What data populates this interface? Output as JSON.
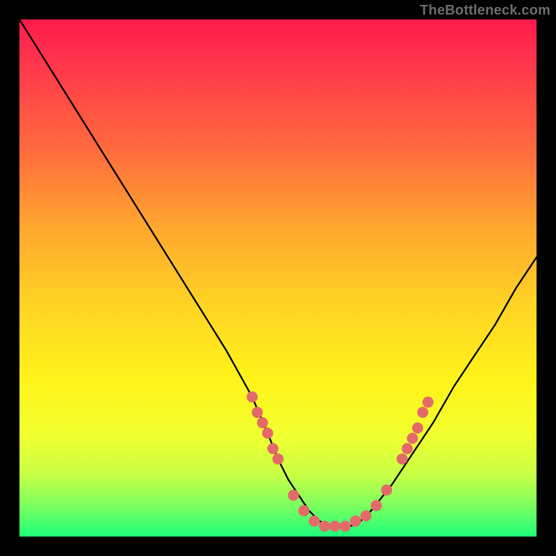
{
  "watermark": "TheBottleneck.com",
  "chart_data": {
    "type": "line",
    "title": "",
    "xlabel": "",
    "ylabel": "",
    "xlim": [
      0,
      100
    ],
    "ylim": [
      0,
      100
    ],
    "series": [
      {
        "name": "bottleneck-curve",
        "x": [
          0,
          5,
          10,
          15,
          20,
          25,
          30,
          35,
          40,
          45,
          48,
          50,
          52,
          54,
          56,
          58,
          60,
          62,
          64,
          66,
          68,
          72,
          76,
          80,
          84,
          88,
          92,
          96,
          100
        ],
        "y": [
          100,
          92,
          84,
          76,
          68,
          60,
          52,
          44,
          36,
          27,
          20,
          15,
          11,
          8,
          5,
          3,
          2,
          2,
          2,
          3,
          5,
          10,
          16,
          22,
          29,
          35,
          41,
          48,
          54
        ]
      }
    ],
    "markers": {
      "name": "highlight-dots",
      "color": "#e46a6a",
      "radius_px": 8,
      "points": [
        {
          "x": 45,
          "y": 27
        },
        {
          "x": 46,
          "y": 24
        },
        {
          "x": 47,
          "y": 22
        },
        {
          "x": 48,
          "y": 20
        },
        {
          "x": 49,
          "y": 17
        },
        {
          "x": 50,
          "y": 15
        },
        {
          "x": 53,
          "y": 8
        },
        {
          "x": 55,
          "y": 5
        },
        {
          "x": 57,
          "y": 3
        },
        {
          "x": 59,
          "y": 2
        },
        {
          "x": 61,
          "y": 2
        },
        {
          "x": 63,
          "y": 2
        },
        {
          "x": 65,
          "y": 3
        },
        {
          "x": 67,
          "y": 4
        },
        {
          "x": 69,
          "y": 6
        },
        {
          "x": 71,
          "y": 9
        },
        {
          "x": 74,
          "y": 15
        },
        {
          "x": 75,
          "y": 17
        },
        {
          "x": 76,
          "y": 19
        },
        {
          "x": 77,
          "y": 21
        },
        {
          "x": 78,
          "y": 24
        },
        {
          "x": 79,
          "y": 26
        }
      ]
    }
  }
}
